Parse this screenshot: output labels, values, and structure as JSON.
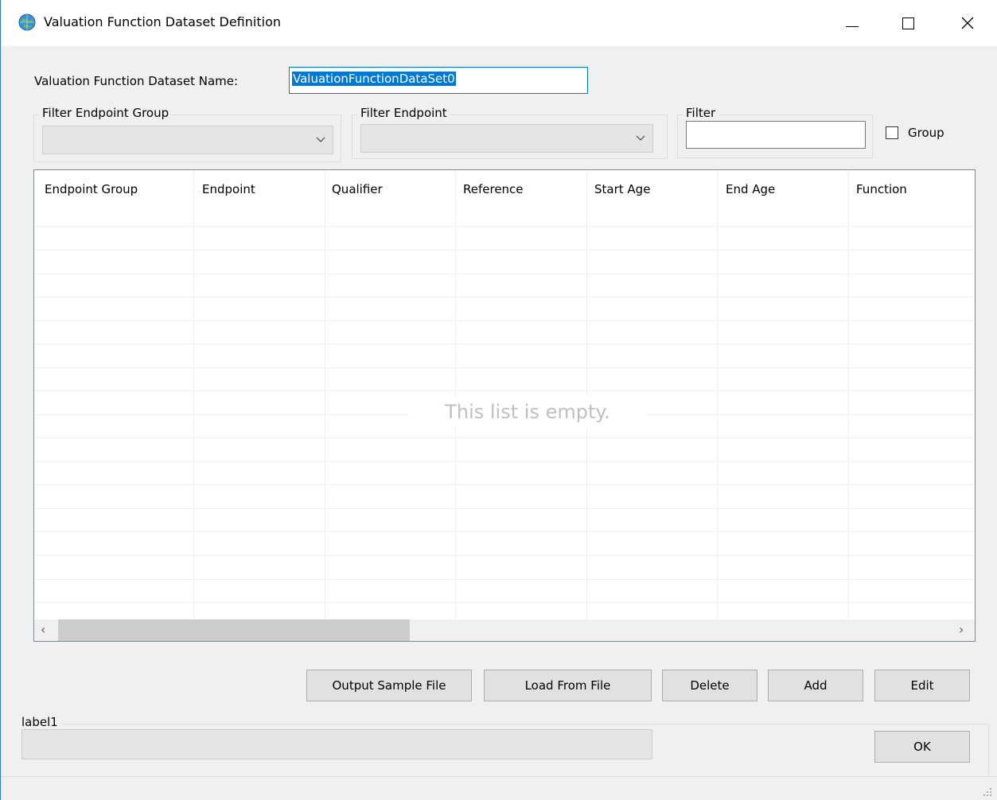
{
  "window": {
    "title": "Valuation Function Dataset Definition",
    "accent": "#0078d7"
  },
  "form": {
    "name_label": "Valuation Function Dataset Name:",
    "name_value": "ValuationFunctionDataSet0",
    "filter_endpoint_group": {
      "title": "Filter Endpoint Group",
      "selected": ""
    },
    "filter_endpoint": {
      "title": "Filter Endpoint",
      "selected": ""
    },
    "filter": {
      "title": "Filter",
      "value": ""
    },
    "group_checkbox": {
      "label": "Group",
      "checked": false
    }
  },
  "list": {
    "columns": [
      "Endpoint Group",
      "Endpoint",
      "Qualifier",
      "Reference",
      "Start Age",
      "End Age",
      "Function"
    ],
    "rows": [],
    "empty_message": "This list is empty."
  },
  "buttons": {
    "output_sample": "Output Sample File",
    "load_from_file": "Load From File",
    "delete": "Delete",
    "add": "Add",
    "edit": "Edit",
    "ok": "OK"
  },
  "status": {
    "title": "label1",
    "value": ""
  },
  "icons": [
    "globe-icon",
    "minimize-icon",
    "maximize-icon",
    "close-icon",
    "chevron-down-icon",
    "scroll-left-icon",
    "scroll-right-icon",
    "resize-grip-icon"
  ]
}
